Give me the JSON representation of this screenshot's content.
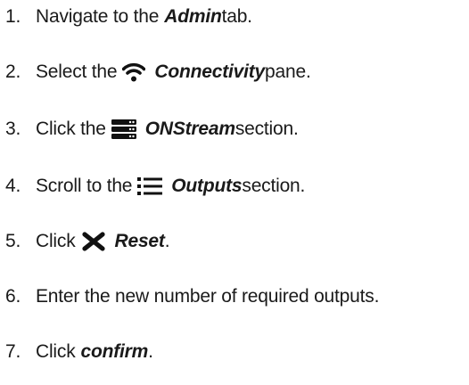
{
  "steps": [
    {
      "number": "1.",
      "pre": "Navigate to the ",
      "emphasis": "Admin",
      "post": " tab.",
      "icon": null
    },
    {
      "number": "2.",
      "pre": "Select the ",
      "emphasis": "Connectivity",
      "post": " pane.",
      "icon": "wifi-icon"
    },
    {
      "number": "3.",
      "pre": "Click the ",
      "emphasis": "ONStream",
      "post": " section.",
      "icon": "server-stack-icon"
    },
    {
      "number": "4.",
      "pre": "Scroll to the ",
      "emphasis": "Outputs",
      "post": " section.",
      "icon": "list-icon"
    },
    {
      "number": "5.",
      "pre": "Click ",
      "emphasis": "Reset",
      "post": ".",
      "icon": "close-x-icon"
    },
    {
      "number": "6.",
      "pre": "Enter the new number of required outputs.",
      "emphasis": "",
      "post": "",
      "icon": null
    },
    {
      "number": "7.",
      "pre": "Click ",
      "emphasis": "confirm",
      "post": ".",
      "icon": null
    }
  ],
  "colors": {
    "text": "#1a1a1a",
    "icon": "#111111"
  }
}
